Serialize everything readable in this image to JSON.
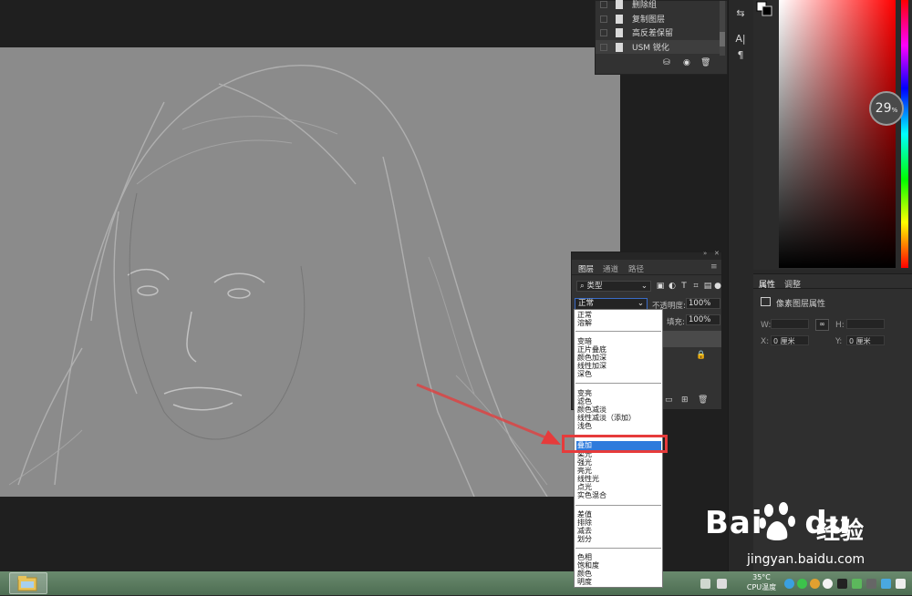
{
  "history": {
    "items": [
      {
        "label": "删除组"
      },
      {
        "label": "复制图层"
      },
      {
        "label": "高反差保留"
      },
      {
        "label": "USM 锐化"
      }
    ]
  },
  "zoom": {
    "value": "29",
    "unit": "%"
  },
  "properties": {
    "tabs": [
      "属性",
      "调整"
    ],
    "title": "像素图层属性",
    "w_label": "W:",
    "h_label": "H:",
    "x_label": "X:",
    "x_value": "0 厘米",
    "y_label": "Y:",
    "y_value": "0 厘米"
  },
  "layers": {
    "tabs": [
      "图层",
      "通道",
      "路径"
    ],
    "filter_label": "类型",
    "blend_mode": "正常",
    "opacity_label": "不透明度:",
    "opacity_value": "100%",
    "fill_label": "填充:",
    "fill_value": "100%"
  },
  "blend_menu": {
    "groups": [
      [
        "正常",
        "溶解"
      ],
      [
        "变暗",
        "正片叠底",
        "颜色加深",
        "线性加深",
        "深色"
      ],
      [
        "变亮",
        "滤色",
        "颜色减淡",
        "线性减淡（添加）",
        "浅色"
      ],
      [
        "叠加",
        "柔光",
        "强光",
        "亮光",
        "线性光",
        "点光",
        "实色混合"
      ],
      [
        "差值",
        "排除",
        "减去",
        "划分"
      ],
      [
        "色相",
        "饱和度",
        "颜色",
        "明度"
      ]
    ],
    "highlighted": "叠加"
  },
  "watermark": {
    "brand": "Bai",
    "brand2": "du",
    "cn": "经验",
    "url": "jingyan.baidu.com"
  },
  "taskbar": {
    "temperature": "35°C",
    "temp_label": "CPU温度"
  },
  "colors": {
    "highlight_frame": "#e63b3b",
    "menu_highlight": "#2f7bdc",
    "canvas_gray": "#8b8b8b"
  }
}
